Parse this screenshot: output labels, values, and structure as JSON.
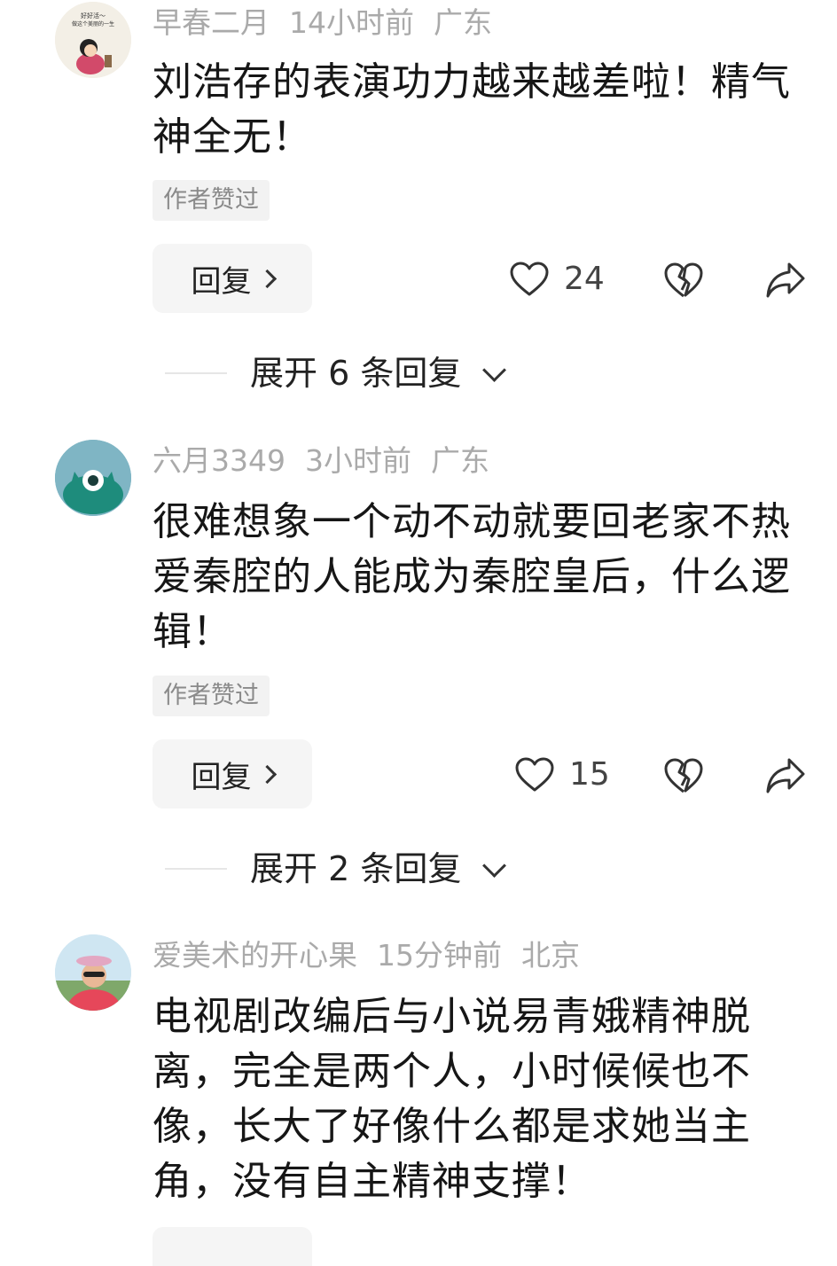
{
  "comments": [
    {
      "user": "早春二月",
      "time": "14小时前",
      "location": "广东",
      "text": "刘浩存的表演功力越来越差啦！精气神全无！",
      "badge": "作者赞过",
      "reply_label": "回复",
      "likes": "24",
      "expand_label": "展开 6 条回复",
      "avatar_text_line1": "好好活～",
      "avatar_text_line2": "做这个美丽的一生"
    },
    {
      "user": "六月3349",
      "time": "3小时前",
      "location": "广东",
      "text": "很难想象一个动不动就要回老家不热爱秦腔的人能成为秦腔皇后，什么逻辑！",
      "badge": "作者赞过",
      "reply_label": "回复",
      "likes": "15",
      "expand_label": "展开 2 条回复"
    },
    {
      "user": "爱美术的开心果",
      "time": "15分钟前",
      "location": "北京",
      "text": "电视剧改编后与小说易青娥精神脱离，完全是两个人，小时候候也不像，长大了好像什么都是求她当主角，没有自主精神支撑！"
    }
  ],
  "colors": {
    "meta": "#aaaaaa",
    "text": "#161616",
    "button_bg": "#f5f5f5",
    "badge_bg": "#f2f2f2"
  },
  "icons": [
    "heart-icon",
    "broken-heart-icon",
    "share-arrow-icon",
    "chevron-right-icon",
    "chevron-down-icon"
  ]
}
